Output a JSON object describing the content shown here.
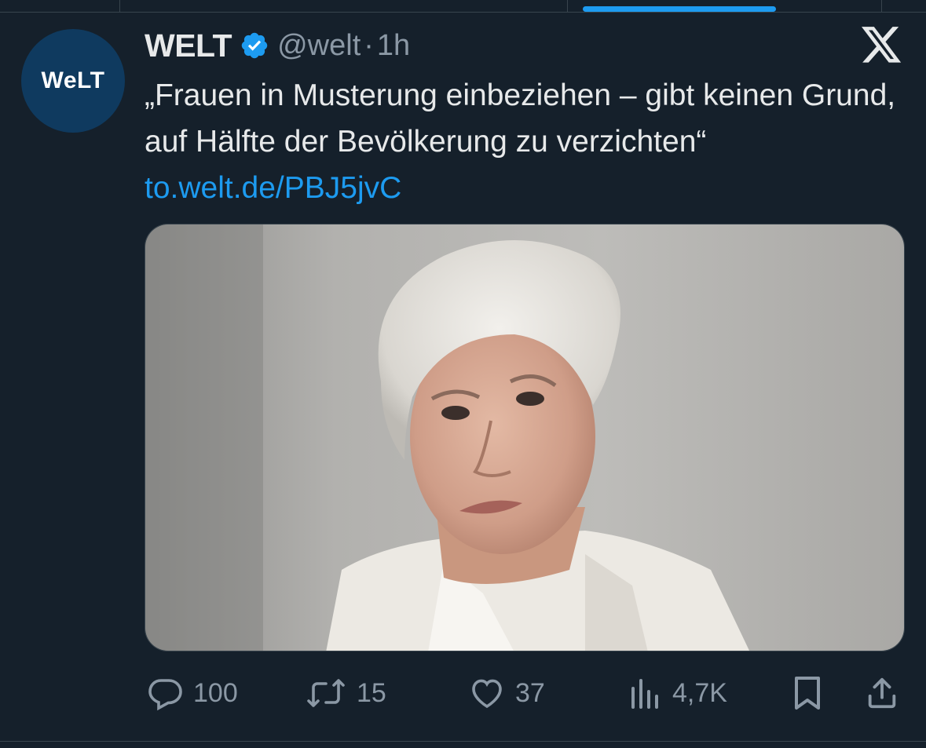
{
  "tweet": {
    "author_name": "WELT",
    "avatar_logo_text": "WELT",
    "verified": true,
    "handle": "@welt",
    "separator": "·",
    "time": "1h",
    "text": "„Frauen in Musterung einbeziehen – gibt keinen Grund, auf Hälfte der Bevölkerung zu verzichten“",
    "link": "to.welt.de/PBJ5jvC"
  },
  "actions": {
    "replies": "100",
    "reposts": "15",
    "likes": "37",
    "views": "4,7K"
  },
  "icons": {
    "verified": "verified-badge-icon",
    "platform": "x-logo-icon",
    "reply": "reply-icon",
    "repost": "repost-icon",
    "like": "like-heart-icon",
    "views": "views-chart-icon",
    "bookmark": "bookmark-icon",
    "share": "share-icon"
  },
  "colors": {
    "background": "#15202b",
    "accent": "#1d9bf0",
    "text_primary": "#e7e9ea",
    "text_secondary": "#8b98a5",
    "avatar_bg": "#0f3a5f"
  }
}
